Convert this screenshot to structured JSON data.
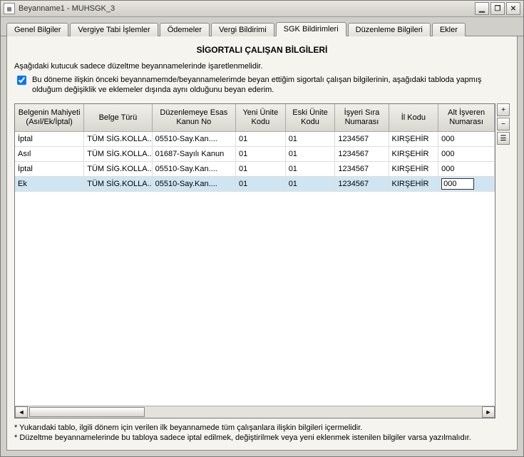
{
  "window": {
    "title": "Beyanname1 - MUHSGK_3"
  },
  "tabs": [
    {
      "label": "Genel Bilgiler"
    },
    {
      "label": "Vergiye Tabi İşlemler"
    },
    {
      "label": "Ödemeler"
    },
    {
      "label": "Vergi Bildirimi"
    },
    {
      "label": "SGK Bildirimleri"
    },
    {
      "label": "Düzenleme Bilgileri"
    },
    {
      "label": "Ekler"
    }
  ],
  "active_tab_index": 4,
  "section": {
    "title": "SİGORTALI ÇALIŞAN BİLGİLERİ",
    "instruction": "Aşağıdaki kutucuk sadece düzeltme beyannamelerinde işaretlenmelidir.",
    "checkbox_label": "Bu döneme ilişkin önceki beyannamemde/beyannamelerimde beyan ettiğim sigortalı çalışan bilgilerinin, aşağıdaki tabloda yapmış olduğum değişiklik ve eklemeler dışında aynı olduğunu beyan ederim.",
    "checkbox_checked": true
  },
  "table": {
    "columns": [
      "Belgenin Mahiyeti (Asıl/Ek/İptal)",
      "Belge Türü",
      "Düzenlemeye Esas Kanun No",
      "Yeni Ünite Kodu",
      "Eski Ünite Kodu",
      "İşyeri Sıra Numarası",
      "İl Kodu",
      "Alt İşveren Numarası"
    ],
    "rows": [
      {
        "c0": "İptal",
        "c1": "TÜM SİG.KOLLA...",
        "c2": "05510-Say.Kan....",
        "c3": "01",
        "c4": "01",
        "c5": "1234567",
        "c6": "KIRŞEHİR",
        "c7": "000"
      },
      {
        "c0": "Asıl",
        "c1": "TÜM SİG.KOLLA...",
        "c2": "01687-Sayılı Kanun",
        "c3": "01",
        "c4": "01",
        "c5": "1234567",
        "c6": "KIRŞEHİR",
        "c7": "000"
      },
      {
        "c0": "İptal",
        "c1": "TÜM SİG.KOLLA...",
        "c2": "05510-Say.Kan....",
        "c3": "01",
        "c4": "01",
        "c5": "1234567",
        "c6": "KIRŞEHİR",
        "c7": "000"
      },
      {
        "c0": "Ek",
        "c1": "TÜM SİG.KOLLA...",
        "c2": "05510-Say.Kan....",
        "c3": "01",
        "c4": "01",
        "c5": "1234567",
        "c6": "KIRŞEHİR",
        "c7": "000"
      }
    ],
    "selected_row_index": 3,
    "editing_cell_value": "000"
  },
  "footnotes": [
    "* Yukarıdaki tablo, ilgili dönem için verilen ilk beyannamede tüm çalışanlara ilişkin bilgileri içermelidir.",
    "* Düzeltme beyannamelerinde bu tabloya sadece iptal edilmek, değiştirilmek veya yeni eklenmek istenilen bilgiler varsa yazılmalıdır."
  ],
  "icons": {
    "minimize": "▁",
    "maximize": "❐",
    "close": "✕",
    "left": "◄",
    "right": "►",
    "add": "+",
    "delete": "−",
    "duplicate": "☰"
  }
}
